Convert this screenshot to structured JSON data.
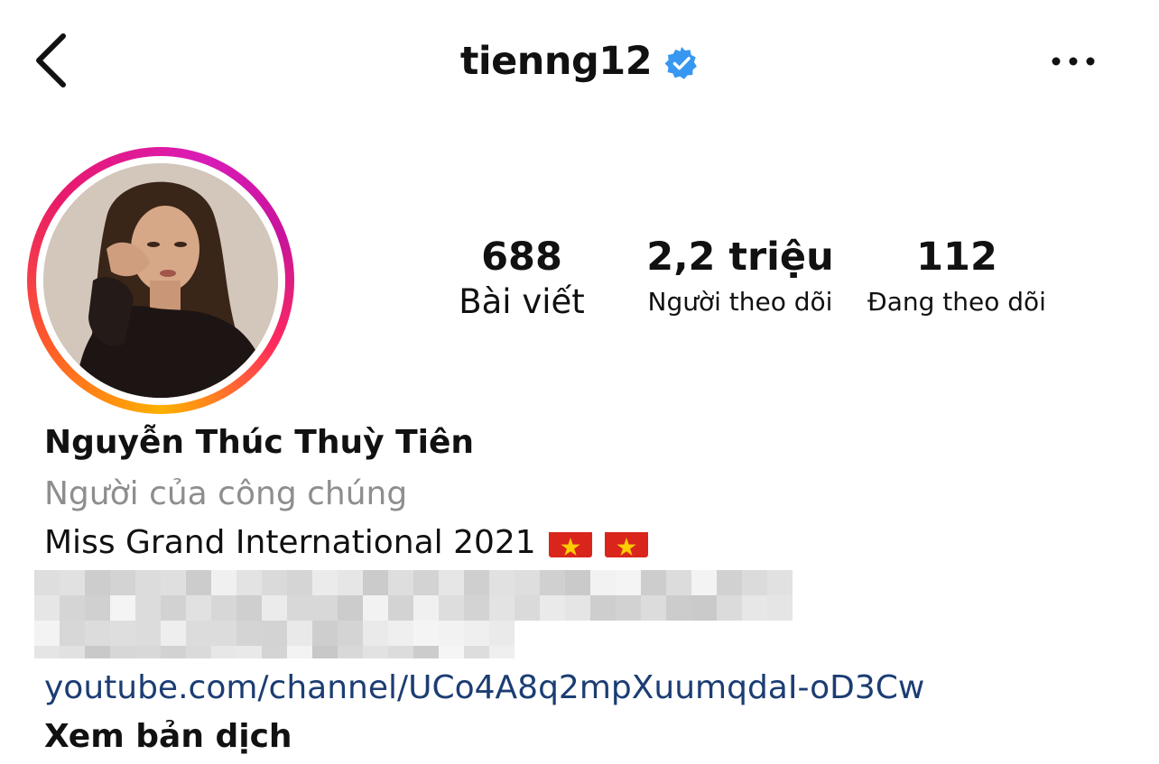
{
  "header": {
    "back_icon": "chevron-left-icon",
    "username": "tienng12",
    "verified_icon": "verified-badge-icon",
    "more_icon": "more-options-icon"
  },
  "profile": {
    "avatar": "profile-photo",
    "stats": [
      {
        "number": "688",
        "label": "Bài viết"
      },
      {
        "number": "2,2 triệu",
        "label": "Người theo dõi"
      },
      {
        "number": "112",
        "label": "Đang theo dõi"
      }
    ],
    "full_name": "Nguyễn Thúc Thuỳ Tiên",
    "category": "Người của công chúng",
    "bio": "Miss Grand International 2021",
    "bio_flags": [
      "vietnam-flag-icon",
      "vietnam-flag-icon"
    ],
    "link": "youtube.com/channel/UCo4A8q2mpXuumqdaI-oD3Cw",
    "translate_label": "Xem bản dịch"
  },
  "colors": {
    "verified_blue": "#3897f0",
    "link_blue": "#1c3d73",
    "secondary_text": "#8e8e8e",
    "flag_red": "#da251d",
    "flag_star": "#ffcd00"
  }
}
